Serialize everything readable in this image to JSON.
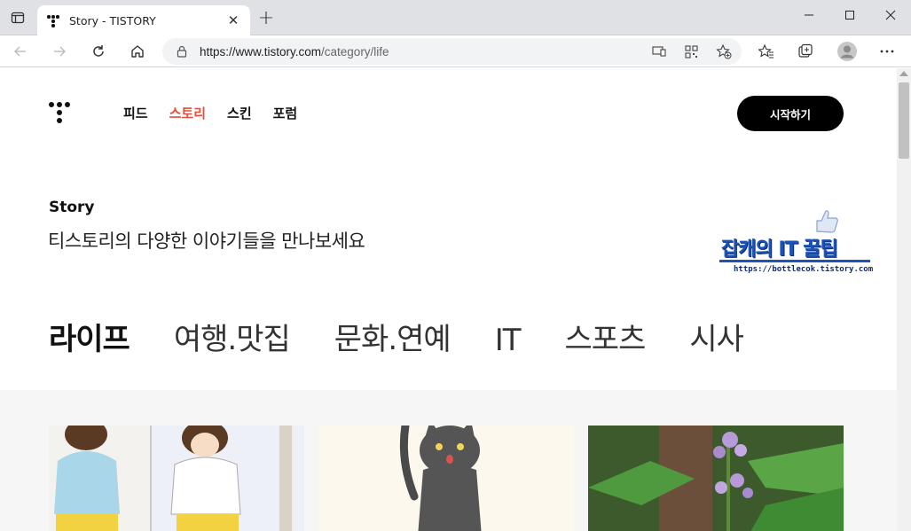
{
  "browser": {
    "tab_title": "Story - TISTORY",
    "url_host": "https://www.tistory.com",
    "url_path": "/category/life"
  },
  "header": {
    "nav": [
      "피드",
      "스토리",
      "스킨",
      "포럼"
    ],
    "active_nav": "스토리",
    "start_button": "시작하기"
  },
  "hero": {
    "title": "Story",
    "description": "티스토리의 다양한 이야기들을 만나보세요"
  },
  "banner": {
    "title": "잡캐의 IT 꿀팁",
    "url": "https://bottlecok.tistory.com"
  },
  "categories": [
    "라이프",
    "여행.맛집",
    "문화.연예",
    "IT",
    "스포츠",
    "시사"
  ],
  "active_category": "라이프",
  "colors": {
    "accent": "#e44e3a",
    "underline": "#ff4d4d",
    "banner_blue": "#1b53b9"
  }
}
